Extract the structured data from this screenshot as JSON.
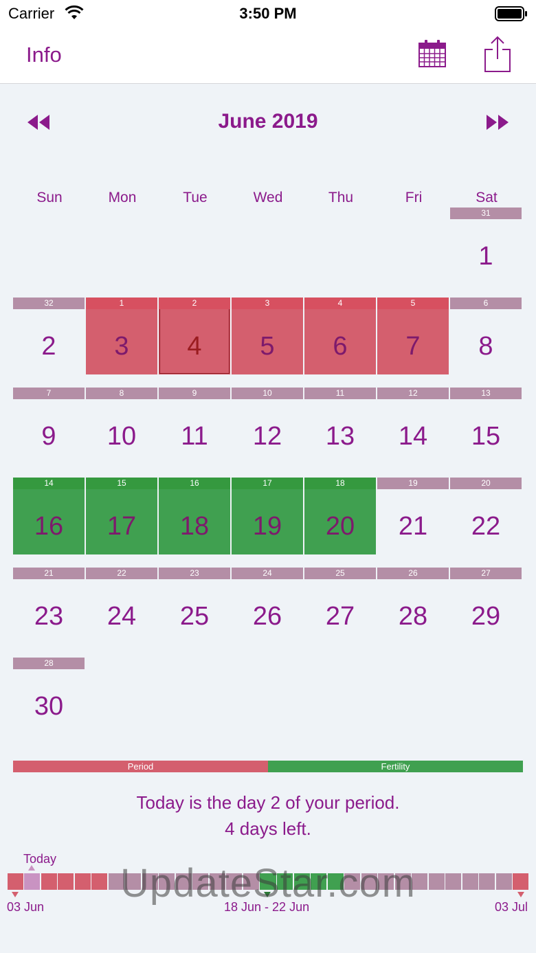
{
  "status_bar": {
    "carrier": "Carrier",
    "time": "3:50 PM"
  },
  "nav": {
    "info_label": "Info",
    "calendar_icon": "calendar-icon",
    "share_icon": "share-icon"
  },
  "month": {
    "title": "June 2019",
    "prev_icon": "rewind-icon",
    "next_icon": "fast-forward-icon"
  },
  "weekdays": [
    "Sun",
    "Mon",
    "Tue",
    "Wed",
    "Thu",
    "Fri",
    "Sat"
  ],
  "calendar": {
    "weeks": [
      [
        null,
        null,
        null,
        null,
        null,
        null,
        {
          "date": "1",
          "cycle_day": "31",
          "state": "normal"
        }
      ],
      [
        {
          "date": "2",
          "cycle_day": "32",
          "state": "normal"
        },
        {
          "date": "3",
          "cycle_day": "1",
          "state": "period"
        },
        {
          "date": "4",
          "cycle_day": "2",
          "state": "period",
          "today": true
        },
        {
          "date": "5",
          "cycle_day": "3",
          "state": "period"
        },
        {
          "date": "6",
          "cycle_day": "4",
          "state": "period"
        },
        {
          "date": "7",
          "cycle_day": "5",
          "state": "period"
        },
        {
          "date": "8",
          "cycle_day": "6",
          "state": "normal"
        }
      ],
      [
        {
          "date": "9",
          "cycle_day": "7",
          "state": "normal"
        },
        {
          "date": "10",
          "cycle_day": "8",
          "state": "normal"
        },
        {
          "date": "11",
          "cycle_day": "9",
          "state": "normal"
        },
        {
          "date": "12",
          "cycle_day": "10",
          "state": "normal"
        },
        {
          "date": "13",
          "cycle_day": "11",
          "state": "normal"
        },
        {
          "date": "14",
          "cycle_day": "12",
          "state": "normal"
        },
        {
          "date": "15",
          "cycle_day": "13",
          "state": "normal"
        }
      ],
      [
        {
          "date": "16",
          "cycle_day": "14",
          "state": "fertile"
        },
        {
          "date": "17",
          "cycle_day": "15",
          "state": "fertile"
        },
        {
          "date": "18",
          "cycle_day": "16",
          "state": "fertile"
        },
        {
          "date": "19",
          "cycle_day": "17",
          "state": "fertile"
        },
        {
          "date": "20",
          "cycle_day": "18",
          "state": "fertile"
        },
        {
          "date": "21",
          "cycle_day": "19",
          "state": "normal"
        },
        {
          "date": "22",
          "cycle_day": "20",
          "state": "normal"
        }
      ],
      [
        {
          "date": "23",
          "cycle_day": "21",
          "state": "normal"
        },
        {
          "date": "24",
          "cycle_day": "22",
          "state": "normal"
        },
        {
          "date": "25",
          "cycle_day": "23",
          "state": "normal"
        },
        {
          "date": "26",
          "cycle_day": "24",
          "state": "normal"
        },
        {
          "date": "27",
          "cycle_day": "25",
          "state": "normal"
        },
        {
          "date": "28",
          "cycle_day": "26",
          "state": "normal"
        },
        {
          "date": "29",
          "cycle_day": "27",
          "state": "normal"
        }
      ],
      [
        {
          "date": "30",
          "cycle_day": "28",
          "state": "normal"
        },
        null,
        null,
        null,
        null,
        null,
        null
      ]
    ]
  },
  "legend": {
    "period": "Period",
    "fertility": "Fertility"
  },
  "message": {
    "line1": "Today is the day 2 of your period.",
    "line2": "4 days left."
  },
  "timeline": {
    "today_label": "Today",
    "start_label": "03 Jun",
    "fertile_label": "18 Jun - 22 Jun",
    "end_label": "03 Jul",
    "segments": [
      "period",
      "todayseg",
      "period",
      "period",
      "period",
      "period",
      "normal",
      "normal",
      "normal",
      "normal",
      "normal",
      "normal",
      "normal",
      "normal",
      "normal",
      "fertile",
      "fertile",
      "fertile",
      "fertile",
      "fertile",
      "normal",
      "normal",
      "normal",
      "normal",
      "normal",
      "normal",
      "normal",
      "normal",
      "normal",
      "normal",
      "period"
    ]
  },
  "watermark": "UpdateStar.com",
  "colors": {
    "accent": "#8b1a8b",
    "period": "#d45f6e",
    "fertility": "#40a050",
    "cycle_strip": "#b48ea6",
    "background": "#eff3f7"
  }
}
